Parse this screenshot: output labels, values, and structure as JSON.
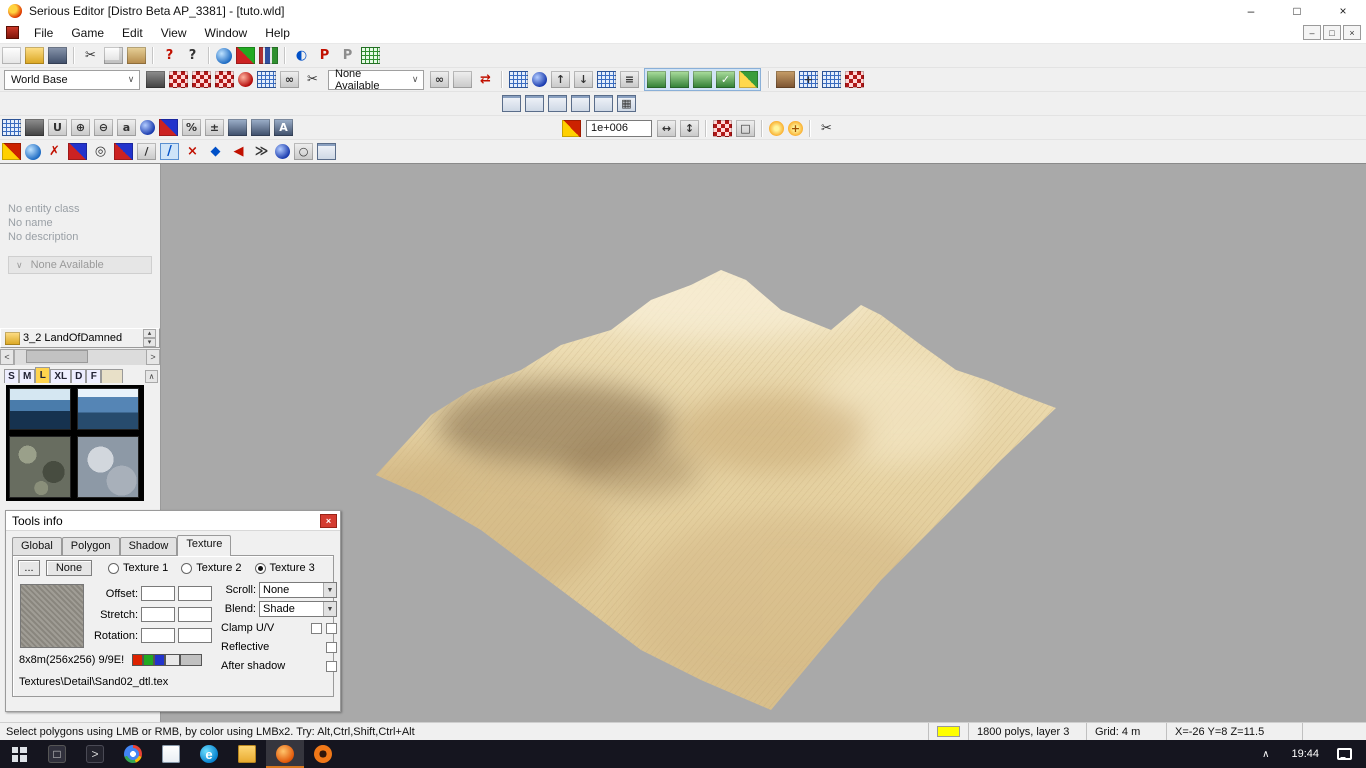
{
  "ui": {
    "combo_arrow": "∨",
    "dropdown_arrow": "▼",
    "spin_up": "▴",
    "spin_down": "▾",
    "scroll_left": "<",
    "scroll_right": ">",
    "scroll_up": "∧",
    "tray_chevron": "∧"
  },
  "window": {
    "title": "Serious Editor [Distro Beta AP_3381] - [tuto.wld]",
    "controls": {
      "minimize": "–",
      "maximize": "□",
      "close": "×"
    }
  },
  "menu": {
    "items": [
      "File",
      "Game",
      "Edit",
      "View",
      "Window",
      "Help"
    ]
  },
  "toolbars": {
    "world_base_combo": "World Base",
    "none_available_combo": "None Available",
    "row4_value": "1e+006",
    "row1": [
      {
        "n": "new-file-icon",
        "cls": "i-page"
      },
      {
        "n": "open-file-icon",
        "cls": "i-folder"
      },
      {
        "n": "save-file-icon",
        "cls": "i-floppy"
      },
      {
        "sep": true
      },
      {
        "n": "cut-icon",
        "cls": "i-none",
        "g": "✂"
      },
      {
        "n": "copy-icon",
        "cls": "i-copy"
      },
      {
        "n": "paste-icon",
        "cls": "i-clip"
      },
      {
        "sep": true
      },
      {
        "n": "help-icon",
        "cls": "i-none gc-red",
        "g": "?"
      },
      {
        "n": "context-help-icon",
        "cls": "i-none",
        "g": "?"
      },
      {
        "sep": true
      },
      {
        "n": "globe-icon",
        "cls": "i-globe"
      },
      {
        "n": "render-mode-icon",
        "cls": "i-redgreen"
      },
      {
        "n": "library-icon",
        "cls": "i-book"
      },
      {
        "sep": true
      },
      {
        "n": "contrast-icon",
        "cls": "i-none gc-blue",
        "g": "◐"
      },
      {
        "n": "p-red-icon",
        "cls": "i-none gc-red",
        "g": "P"
      },
      {
        "n": "p-gray-icon",
        "cls": "i-none gc-gray",
        "g": "P"
      },
      {
        "n": "green-grid-icon",
        "cls": "i-grngrid"
      }
    ],
    "row2a": [
      {
        "n": "anchor-entity-icon",
        "cls": "i-dark"
      },
      {
        "n": "world-paint-1-icon",
        "cls": "i-redck"
      },
      {
        "n": "world-paint-2-icon",
        "cls": "i-redck"
      },
      {
        "n": "world-paint-3-icon",
        "cls": "i-redck"
      },
      {
        "n": "red-sphere-icon",
        "cls": "i-ballred"
      },
      {
        "n": "blue-grid-icon",
        "cls": "i-blugrid"
      },
      {
        "n": "link-chain-icon",
        "cls": "i-gray",
        "g": "∞"
      },
      {
        "n": "detach-icon",
        "cls": "i-none",
        "g": "✂"
      }
    ],
    "row2b": [
      {
        "n": "attach-icon",
        "cls": "i-gray",
        "g": "∞"
      },
      {
        "n": "unlink-icon",
        "cls": "i-gray"
      },
      {
        "n": "swap-arrows-icon",
        "cls": "i-none gc-red",
        "g": "⇄"
      }
    ],
    "row2c": [
      {
        "n": "paste-alt-icon",
        "cls": "i-blugrid"
      },
      {
        "n": "blue-sphere-icon",
        "cls": "i-ballblue"
      }
    ],
    "row2d": [
      {
        "n": "move-up-icon",
        "cls": "i-gray",
        "g": "↑"
      },
      {
        "n": "move-down-icon",
        "cls": "i-gray",
        "g": "↓"
      },
      {
        "n": "sort-grid-icon",
        "cls": "i-blugrid"
      },
      {
        "n": "list-view-icon",
        "cls": "i-gray",
        "g": "≡"
      }
    ],
    "row2e": [
      {
        "n": "layer-a-icon",
        "cls": "i-grn"
      },
      {
        "n": "layer-b-icon",
        "cls": "i-grn"
      },
      {
        "n": "layer-c-icon",
        "cls": "i-grn"
      },
      {
        "n": "layer-check-icon",
        "cls": "i-grn",
        "g": "✓"
      },
      {
        "n": "layer-paint-icon",
        "cls": "i-yelgrn"
      }
    ],
    "row2f": [
      {
        "n": "terrain-brush-icon",
        "cls": "i-brown"
      },
      {
        "n": "grid-plus-icon",
        "cls": "i-blugrid",
        "g": "+"
      },
      {
        "n": "grid-cells-icon",
        "cls": "i-blugrid"
      },
      {
        "n": "checker-red-icon",
        "cls": "i-redck"
      }
    ],
    "row3": [
      {
        "n": "viewport-frame-1-icon",
        "cls": "i-frame"
      },
      {
        "n": "viewport-frame-2-icon",
        "cls": "i-frame"
      },
      {
        "n": "viewport-frame-3-icon",
        "cls": "i-frame"
      },
      {
        "n": "viewport-frame-4-icon",
        "cls": "i-frame"
      },
      {
        "n": "viewport-frame-5-icon",
        "cls": "i-frame"
      },
      {
        "n": "viewport-grid-icon",
        "cls": "i-frame",
        "g": "▦"
      }
    ],
    "row4a": [
      {
        "n": "snap-grid-icon",
        "cls": "i-blugrid"
      },
      {
        "n": "lock-icon",
        "cls": "i-dark"
      },
      {
        "n": "magnet-icon",
        "cls": "i-gray",
        "g": "U"
      },
      {
        "n": "zoom-in-icon",
        "cls": "i-gray",
        "g": "⊕"
      },
      {
        "n": "zoom-out-icon",
        "cls": "i-gray",
        "g": "⊖"
      },
      {
        "n": "font-icon",
        "cls": "i-gray",
        "g": "a"
      },
      {
        "n": "shield-icon",
        "cls": "i-ballblue"
      },
      {
        "n": "axes-icon",
        "cls": "i-redblue"
      },
      {
        "n": "percent-icon",
        "cls": "i-gray",
        "g": "%"
      },
      {
        "n": "measure-icon",
        "cls": "i-gray",
        "g": "±"
      },
      {
        "n": "snapshot-1-icon",
        "cls": "i-photo"
      },
      {
        "n": "snapshot-2-icon",
        "cls": "i-photo"
      },
      {
        "n": "snapshot-a-icon",
        "cls": "i-photo",
        "g": "A"
      }
    ],
    "row4b_pre": [
      {
        "n": "range-icon",
        "cls": "i-redyellow"
      }
    ],
    "row4b": [
      {
        "n": "fit-h-icon",
        "cls": "i-gray",
        "g": "↔"
      },
      {
        "n": "fit-v-icon",
        "cls": "i-gray",
        "g": "↕"
      },
      {
        "sep": true
      },
      {
        "n": "subdivide-icon",
        "cls": "i-redck"
      },
      {
        "n": "bounding-box-icon",
        "cls": "i-gray",
        "g": "□"
      },
      {
        "sep": true
      },
      {
        "n": "light-icon",
        "cls": "i-sun"
      },
      {
        "n": "light-add-icon",
        "cls": "i-sun",
        "g": "+"
      },
      {
        "sep": true
      },
      {
        "n": "cut-polygon-icon",
        "cls": "i-none",
        "g": "✂"
      }
    ],
    "row5": [
      {
        "n": "paint-pour-icon",
        "cls": "i-redyellow"
      },
      {
        "n": "world-globe-2-icon",
        "cls": "i-globe"
      },
      {
        "n": "delete-red-icon",
        "cls": "i-none gc-red",
        "g": "✗"
      },
      {
        "n": "swap-texture-icon",
        "cls": "i-redblue"
      },
      {
        "n": "eye-icon",
        "cls": "i-none",
        "g": "◎"
      },
      {
        "n": "flip-texture-icon",
        "cls": "i-redblue"
      },
      {
        "n": "pencil-gray-icon",
        "cls": "i-gray",
        "g": "/"
      },
      {
        "n": "slope-tool-icon",
        "cls": "i-none gc-blue hl",
        "g": "/"
      },
      {
        "n": "erase-small-icon",
        "cls": "i-none gc-red",
        "g": "×"
      },
      {
        "n": "diamond-icon",
        "cls": "i-none gc-blue",
        "g": "◆"
      },
      {
        "n": "step-back-icon",
        "cls": "i-none gc-red",
        "g": "◀"
      },
      {
        "n": "fast-forward-icon",
        "cls": "i-none",
        "g": "≫"
      },
      {
        "n": "sphere-blue-2-icon",
        "cls": "i-ballblue"
      },
      {
        "n": "circle-outline-icon",
        "cls": "i-gray",
        "g": "○"
      },
      {
        "n": "frame-box-icon",
        "cls": "i-frame"
      }
    ]
  },
  "left_panel": {
    "entity_class": "No entity class",
    "name": "No name",
    "description": "No description",
    "combo": "None Available",
    "browser": {
      "title": "3_2 LandOfDamned",
      "tabs": [
        "S",
        "M",
        "L",
        "XL",
        "D",
        "F",
        ""
      ],
      "active_tab": 2
    }
  },
  "tools_info": {
    "title": "Tools info",
    "close_glyph": "×",
    "tabs": [
      "Global",
      "Polygon",
      "Shadow",
      "Texture"
    ],
    "active_tab": 3,
    "browse_button": "...",
    "none_button": "None",
    "radios": [
      "Texture 1",
      "Texture 2",
      "Texture 3"
    ],
    "selected_radio": 2,
    "field_labels": [
      "Offset:",
      "Stretch:",
      "Rotation:"
    ],
    "scroll_label": "Scroll:",
    "scroll_value": "None",
    "blend_label": "Blend:",
    "blend_value": "Shade",
    "clamp_label": "Clamp U/V",
    "reflective_label": "Reflective",
    "after_shadow_label": "After shadow",
    "size_info": "8x8m(256x256) 9/9E!",
    "swatches": [
      "#dd2200",
      "#22aa22",
      "#2233cc",
      "#e8e8e8",
      "#c0c0c0"
    ],
    "path": "Textures\\Detail\\Sand02_dtl.tex"
  },
  "status_bar": {
    "message": "Select polygons using LMB or RMB, by color using LMBx2. Try: Alt,Ctrl,Shift,Ctrl+Alt",
    "swatch_color": "#ffff00",
    "polys": "1800 polys, layer 3",
    "grid": "Grid: 4 m",
    "coords": "X=-26 Y=8 Z=11.5"
  },
  "taskbar": {
    "time": "19:44",
    "items": [
      {
        "n": "start-button",
        "cls": "tb-win"
      },
      {
        "n": "task-view-icon",
        "cls": "tb-dark",
        "g": "□"
      },
      {
        "n": "console-icon",
        "cls": "tb-tile-dark",
        "g": ">"
      },
      {
        "n": "chrome-icon",
        "cls": "tb-chrome"
      },
      {
        "n": "notepad-icon",
        "cls": "tb-doc"
      },
      {
        "n": "edge-icon",
        "cls": "tb-edge",
        "g": "e"
      },
      {
        "n": "file-explorer-icon",
        "cls": "tb-folder"
      },
      {
        "n": "serious-editor-icon",
        "cls": "tb-orange",
        "active": true
      },
      {
        "n": "serious-sam-icon",
        "cls": "tb-orange2"
      }
    ]
  }
}
